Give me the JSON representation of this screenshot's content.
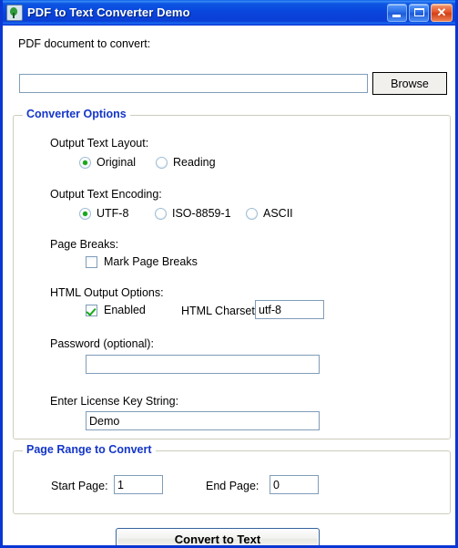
{
  "window": {
    "title": "PDF to Text Converter Demo",
    "icon": "app-pdf-icon",
    "minimize_label": "Minimize",
    "maximize_label": "Maximize",
    "close_label": "Close",
    "close_glyph": "✕",
    "accent_color": "#0a45db",
    "legend_color": "#1436c8",
    "check_color": "#17a81a"
  },
  "top": {
    "file_label": "PDF document to convert:",
    "file_value": "",
    "file_placeholder": "",
    "browse_label": "Browse"
  },
  "converter": {
    "legend": "Converter Options",
    "layout": {
      "label": "Output Text Layout:",
      "options": [
        {
          "label": "Original",
          "selected": true
        },
        {
          "label": "Reading",
          "selected": false
        }
      ]
    },
    "encoding": {
      "label": "Output Text Encoding:",
      "options": [
        {
          "label": "UTF-8",
          "selected": true
        },
        {
          "label": "ISO-8859-1",
          "selected": false
        },
        {
          "label": "ASCII",
          "selected": false
        }
      ]
    },
    "page_breaks": {
      "label": "Page Breaks:",
      "checkbox_label": "Mark Page Breaks",
      "checked": false
    },
    "html_output": {
      "label": "HTML Output Options:",
      "checkbox_label": "Enabled",
      "checked": true,
      "charset_label": "HTML Charset:",
      "charset_value": "utf-8"
    },
    "password": {
      "label": "Password (optional):",
      "value": ""
    },
    "license": {
      "label": "Enter License Key String:",
      "value": "Demo"
    }
  },
  "page_range": {
    "legend": "Page Range to Convert",
    "start_label": "Start Page:",
    "start_value": "1",
    "end_label": "End Page:",
    "end_value": "0"
  },
  "actions": {
    "convert_label": "Convert to Text"
  }
}
